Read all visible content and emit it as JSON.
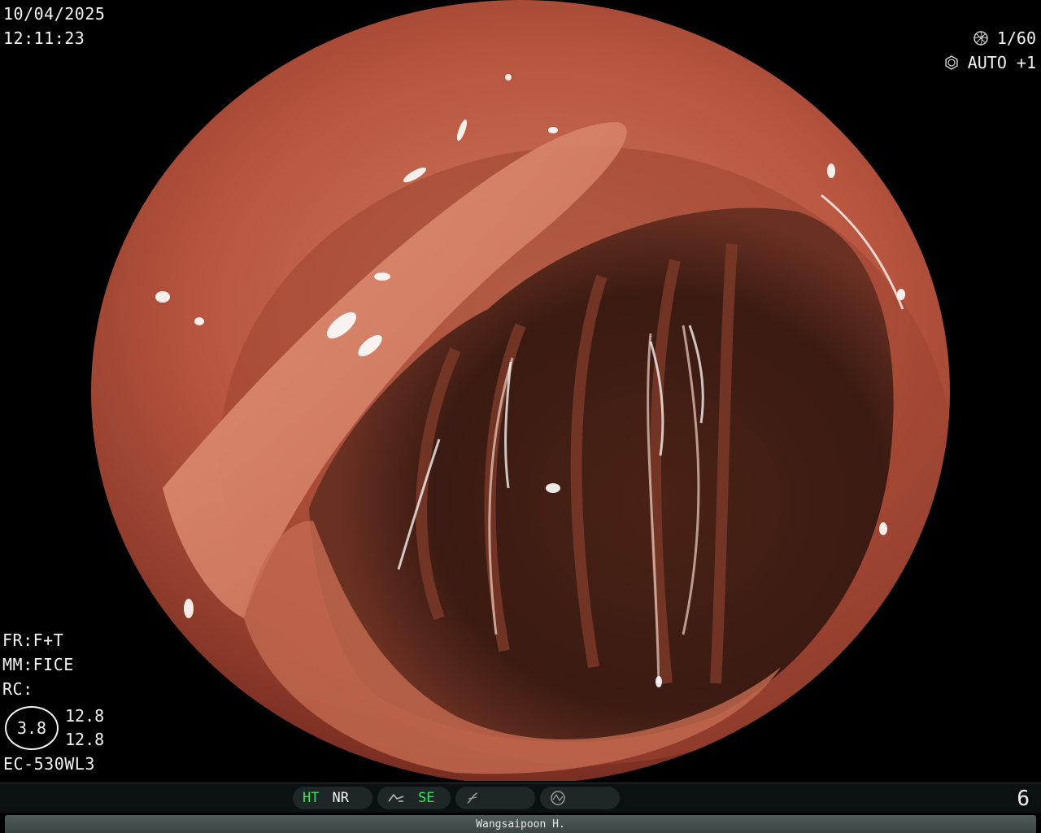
{
  "overlay": {
    "date": "10/04/2025",
    "time": "12:11:23",
    "shutter": "1/60",
    "iris": "AUTO +1",
    "fr": "FR:F+T",
    "mm": "MM:FICE",
    "rc": "RC:",
    "ratio_main": "3.8",
    "ratio_top": "12.8",
    "ratio_bottom": "12.8",
    "scope_model": "EC-530WL3"
  },
  "status_bar": {
    "ht": "HT",
    "nr": "NR",
    "se": "SE",
    "frame_number": "6"
  },
  "footer": {
    "operator": "Wangsaipoon H."
  },
  "colors": {
    "status_green": "#34e65a",
    "mucosa": "#b8553f",
    "lumen": "#3a1a12"
  }
}
